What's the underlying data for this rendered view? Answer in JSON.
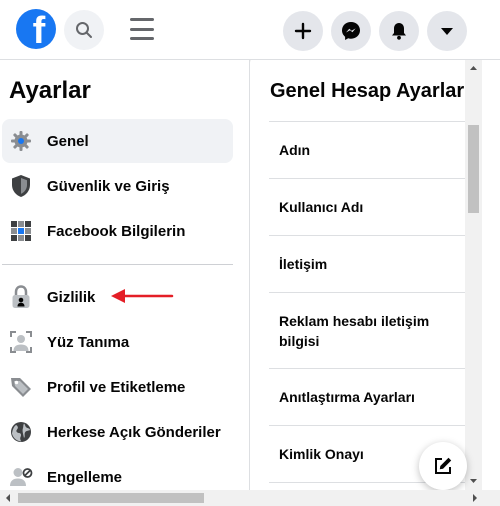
{
  "header": {
    "logo_letter": "f",
    "icons": {
      "logo": "facebook-logo",
      "search": "search-icon",
      "menu": "hamburger-menu-icon",
      "create": "plus-icon",
      "messenger": "messenger-icon",
      "notifications": "bell-icon",
      "account": "caret-down-icon"
    }
  },
  "sidebar": {
    "title": "Ayarlar",
    "items": [
      {
        "label": "Genel",
        "icon": "gear-icon",
        "active": true
      },
      {
        "label": "Güvenlik ve Giriş",
        "icon": "shield-icon",
        "active": false
      },
      {
        "label": "Facebook Bilgilerin",
        "icon": "grid-icon",
        "active": false
      },
      {
        "label": "Gizlilik",
        "icon": "lock-icon",
        "active": false
      },
      {
        "label": "Yüz Tanıma",
        "icon": "face-recognition-icon",
        "active": false
      },
      {
        "label": "Profil ve Etiketleme",
        "icon": "tag-icon",
        "active": false
      },
      {
        "label": "Herkese Açık Gönderiler",
        "icon": "globe-icon",
        "active": false
      },
      {
        "label": "Engelleme",
        "icon": "block-user-icon",
        "active": false
      }
    ]
  },
  "main": {
    "title": "Genel Hesap Ayarları",
    "rows": [
      {
        "label": "Adın"
      },
      {
        "label": "Kullanıcı Adı"
      },
      {
        "label": "İletişim"
      },
      {
        "label": "Reklam hesabı iletişim bilgisi"
      },
      {
        "label": "Anıtlaştırma Ayarları"
      },
      {
        "label": "Kimlik Onayı"
      }
    ],
    "compose_icon": "edit-icon"
  },
  "colors": {
    "brand": "#1877f2",
    "annotation_arrow": "#e41e26"
  }
}
